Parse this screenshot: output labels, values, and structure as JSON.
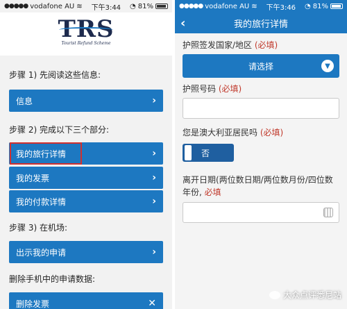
{
  "colors": {
    "primary": "#1d78c1",
    "required": "#c0392b",
    "highlight": "#d0302f"
  },
  "left": {
    "status": {
      "carrier": "vodafone AU",
      "time": "下午3:44",
      "battery": "81%"
    },
    "logo": {
      "text": "TRS",
      "tagline": "Tourist Refund Scheme"
    },
    "step1": "步骤 1) 先阅读这些信息:",
    "info_button": "信息",
    "step2": "步骤 2) 完成以下三个部分:",
    "section_buttons": [
      "我的旅行详情",
      "我的发票",
      "我的付款详情"
    ],
    "step3": "步骤 3) 在机场:",
    "show_claim_button": "出示我的申请",
    "delete_heading": "删除手机中的申请数据:",
    "delete_invoice_button": "删除发票"
  },
  "right": {
    "status": {
      "carrier": "vodafone AU",
      "time": "下午3:46",
      "battery": "81%"
    },
    "nav_title": "我的旅行详情",
    "passport_country_label": "护照签发国家/地区",
    "required": "(必填)",
    "select_placeholder": "请选择",
    "passport_number_label": "护照号码",
    "resident_label": "您是澳大利亚居民吗",
    "resident_value": "否",
    "departure_label_line1": "离开日期(两位数日期/两位数月份/四位数",
    "departure_label_line2": "年份,",
    "watermark": "大众点评悉尼站"
  }
}
